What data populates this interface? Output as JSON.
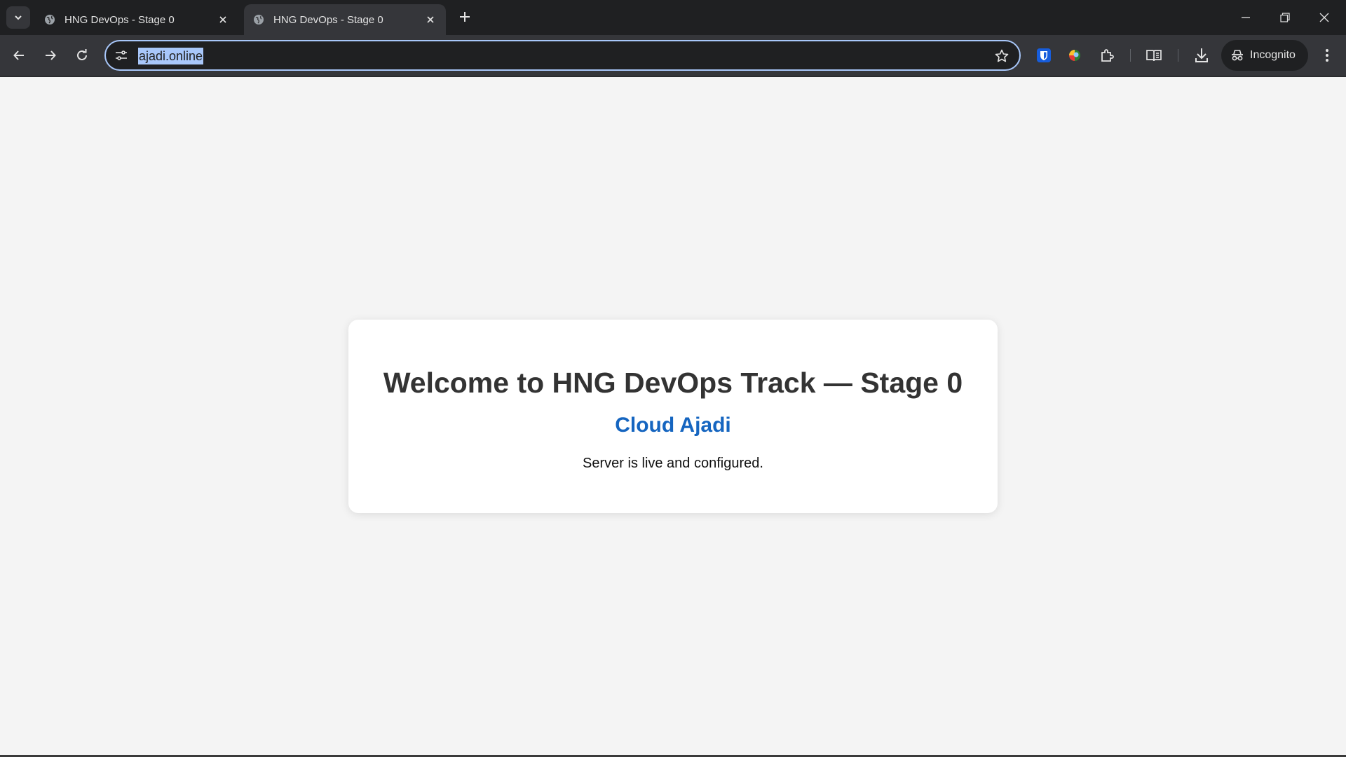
{
  "browser": {
    "tabs": [
      {
        "title": "HNG DevOps - Stage 0",
        "active": false
      },
      {
        "title": "HNG DevOps - Stage 0",
        "active": true
      }
    ],
    "address_bar": {
      "url": "ajadi.online",
      "selected": true
    },
    "profile_label": "Incognito",
    "icons": {
      "tab_search": "chevron-down-icon",
      "favicon": "globe-icon",
      "close": "close-icon",
      "new_tab": "plus-icon",
      "back": "arrow-left-icon",
      "forward": "arrow-right-icon",
      "reload": "reload-icon",
      "site_info": "tune-icon",
      "bookmark": "star-icon",
      "extensions": [
        "bitwarden-shield-icon",
        "colorful-extension-icon",
        "puzzle-icon"
      ],
      "reading_mode": "book-icon",
      "downloads": "download-icon",
      "menu": "kebab-menu-icon"
    },
    "colors": {
      "accent": "#a8c7fa",
      "chrome_dark": "#1f2022",
      "toolbar": "#35363a"
    }
  },
  "page": {
    "heading": "Welcome to HNG DevOps Track — Stage 0",
    "subheading": "Cloud Ajadi",
    "status": "Server is live and configured.",
    "colors": {
      "background": "#f4f4f4",
      "card": "#ffffff",
      "heading": "#333333",
      "subheading": "#1565c0"
    }
  }
}
